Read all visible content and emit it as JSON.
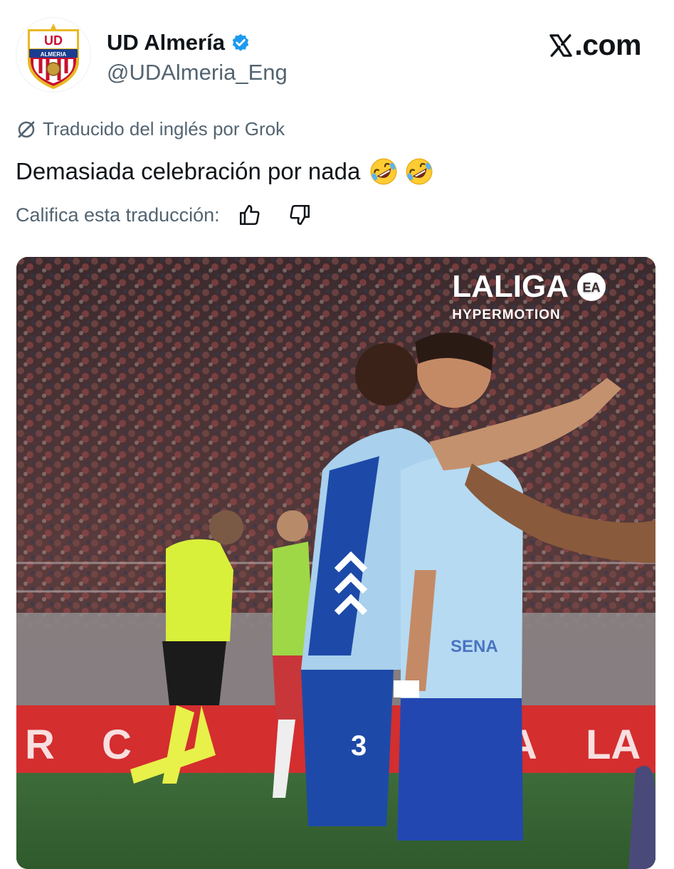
{
  "account": {
    "display_name": "UD Almería",
    "handle": "@UDAlmeria_Eng",
    "verified": true,
    "avatar_icon": "ud-almeria-crest",
    "crest_text": "UD",
    "crest_banner": "ALMERIA"
  },
  "brand": {
    "label": ".com",
    "icon": "x-logo"
  },
  "translation": {
    "notice": "Traducido del inglés por Grok",
    "icon": "grok-icon"
  },
  "tweet": {
    "text": "Demasiada celebración por nada",
    "emojis": [
      "rolling-on-the-floor-laughing",
      "rolling-on-the-floor-laughing"
    ]
  },
  "rating": {
    "prompt": "Califica esta traducción:",
    "up_icon": "thumbs-up-icon",
    "down_icon": "thumbs-down-icon"
  },
  "media": {
    "type": "video-frame",
    "overlay_title": "LALIGA",
    "overlay_subtitle": "HYPERMOTION",
    "overlay_badge": "ea-sports-logo",
    "jersey_number_visible": "3",
    "sponsor_visible": "SENA"
  },
  "colors": {
    "text": "#0f1419",
    "secondary": "#536471",
    "verified": "#1d9bf0",
    "accent_red": "#d42e2f"
  }
}
